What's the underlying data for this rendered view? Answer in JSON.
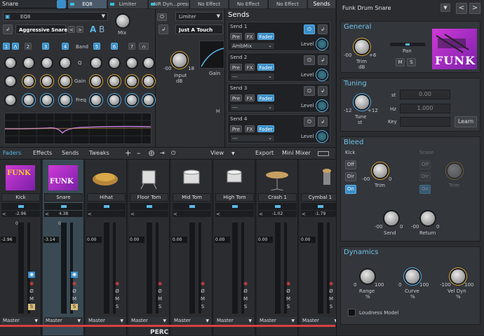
{
  "topbar": {
    "title": "Snare",
    "slots": [
      "EQ8",
      "Limiter",
      "AIR Dyn...pressor",
      "No Effect",
      "No Effect",
      "No Effect"
    ],
    "sends_label": "Sends"
  },
  "eq": {
    "name": "EQ8",
    "preset": "Aggressive Snare",
    "ab_a": "A",
    "ab_b": "B",
    "mix_label": "Mix",
    "bands": [
      "1",
      "2",
      "3",
      "4",
      "5",
      "6",
      "7",
      "8"
    ],
    "band_label": "Band",
    "q_label": "Q",
    "gain_label": "Gain",
    "freq_label": "Freq"
  },
  "limiter": {
    "name": "Limiter",
    "preset": "Just A Touch",
    "input_label": "Input",
    "input_unit": "dB",
    "input_min": "-00",
    "input_max": "18",
    "gain_label": "Gain",
    "h_label": "H"
  },
  "sends": {
    "title": "Sends",
    "items": [
      {
        "name": "Send 1",
        "pre": "Pre",
        "fx": "FX",
        "fader": "Fader",
        "dest": "AmbMix",
        "level": "Level"
      },
      {
        "name": "Send 2",
        "pre": "Pre",
        "fx": "FX",
        "fader": "Fader",
        "dest": "---",
        "level": "Level"
      },
      {
        "name": "Send 3",
        "pre": "Pre",
        "fx": "FX",
        "fader": "Fader",
        "dest": "---",
        "level": "Level"
      },
      {
        "name": "Send 4",
        "pre": "Pre",
        "fx": "FX",
        "fader": "Fader",
        "dest": "---",
        "level": "Level"
      }
    ]
  },
  "tabs": {
    "faders": "Faders",
    "effects": "Effects",
    "sends": "Sends",
    "tweaks": "Tweaks",
    "view": "View",
    "export": "Export",
    "mini_mixer": "Mini Mixer"
  },
  "channels": [
    {
      "name": "Kick",
      "pan_val": "-2.96",
      "fader_val": "-2.96",
      "output": "Master",
      "zero": "0"
    },
    {
      "name": "Snare",
      "pan_val": "4.38",
      "fader_val": "-3.14",
      "output": "Master",
      "zero": "0"
    },
    {
      "name": "Hihat",
      "pan_val": "",
      "fader_val": "0.00",
      "output": "Master",
      "zero": ""
    },
    {
      "name": "Floor Tom",
      "pan_val": "",
      "fader_val": "0.00",
      "output": "Master",
      "zero": ""
    },
    {
      "name": "Mid Tom",
      "pan_val": "",
      "fader_val": "0.00",
      "output": "Master",
      "zero": ""
    },
    {
      "name": "High Tom",
      "pan_val": "",
      "fader_val": "0.00",
      "output": "Master",
      "zero": ""
    },
    {
      "name": "Crash 1",
      "pan_val": "-1.02",
      "fader_val": "0.00",
      "output": "Master",
      "zero": ""
    },
    {
      "name": "Cymbal 1",
      "pan_val": "-1.79",
      "fader_val": "0.00",
      "output": "Master",
      "zero": ""
    }
  ],
  "side": {
    "kit_name": "Funk Drum Snare",
    "general": {
      "title": "General",
      "trim": "Trim",
      "trim_unit": "dB",
      "trim_min": "-00",
      "trim_max": "+6",
      "pan": "Pan",
      "m": "M",
      "s": "S",
      "logo": "FUNK"
    },
    "tuning": {
      "title": "Tuning",
      "tune": "Tune",
      "tune_unit": "st",
      "tune_min": "-12",
      "tune_max": "+12",
      "st_label": "st",
      "st_val": "0.00",
      "hz_label": "Hz",
      "hz_val": "1.000",
      "key_label": "Key",
      "learn": "Learn"
    },
    "bleed": {
      "title": "Bleed",
      "kick": "Kick",
      "snare": "Snare",
      "off": "Off",
      "dir": "Dir",
      "on": "On",
      "trim": "Trim",
      "send": "Send",
      "return": "Return",
      "min": "-00",
      "zero": "0"
    },
    "dynamics": {
      "title": "Dynamics",
      "range": "Range",
      "curve": "Curve",
      "vel_dyn": "Vel Dyn",
      "pct": "%",
      "r_min": "0",
      "r_max": "100",
      "c_min": "0",
      "c_max": "100",
      "v_min": "-100",
      "v_max": "100",
      "loudness": "Loudness Model"
    }
  },
  "footer": "PERC",
  "colors": {
    "accent": "#5ab8e6",
    "knob_yellow": "#d9a53a",
    "red": "#d94040"
  }
}
